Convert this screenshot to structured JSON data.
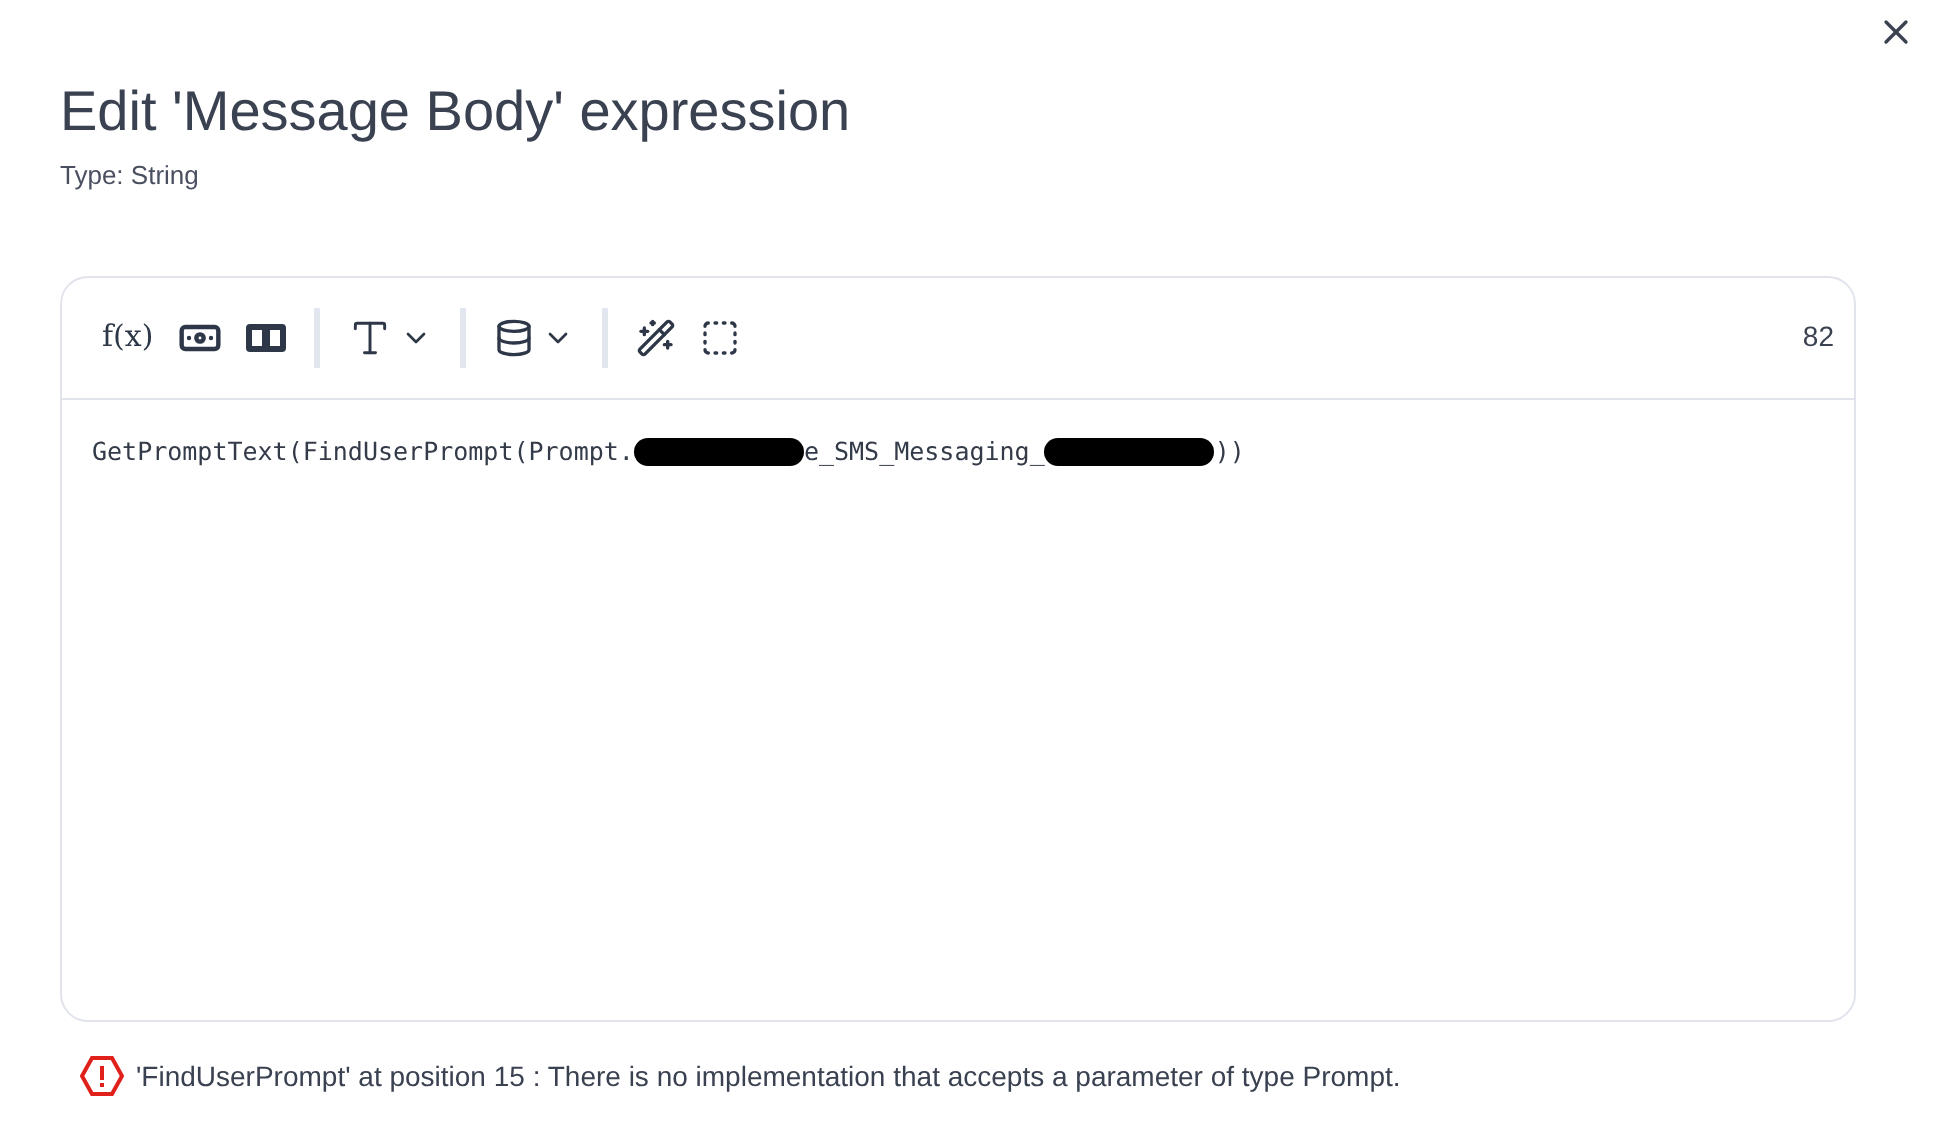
{
  "dialog": {
    "title": "Edit 'Message Body' expression",
    "subtitle": "Type: String"
  },
  "toolbar": {
    "items": [
      {
        "kind": "function",
        "label": "f(x)"
      },
      {
        "kind": "money"
      },
      {
        "kind": "translate"
      },
      {
        "kind": "separator"
      },
      {
        "kind": "font",
        "dropdown": true
      },
      {
        "kind": "separator"
      },
      {
        "kind": "database",
        "dropdown": true
      },
      {
        "kind": "separator"
      },
      {
        "kind": "magic"
      },
      {
        "kind": "select"
      }
    ],
    "count": "82"
  },
  "editor": {
    "segments": [
      {
        "kind": "text",
        "text": "GetPromptText(FindUserPrompt(Prompt."
      },
      {
        "kind": "redacted"
      },
      {
        "kind": "text",
        "text": "e_SMS_Messaging_"
      },
      {
        "kind": "redacted"
      },
      {
        "kind": "text",
        "text": "))"
      }
    ]
  },
  "error": {
    "text": "'FindUserPrompt' at position 15 : There is no implementation that accepts a parameter of type Prompt."
  }
}
